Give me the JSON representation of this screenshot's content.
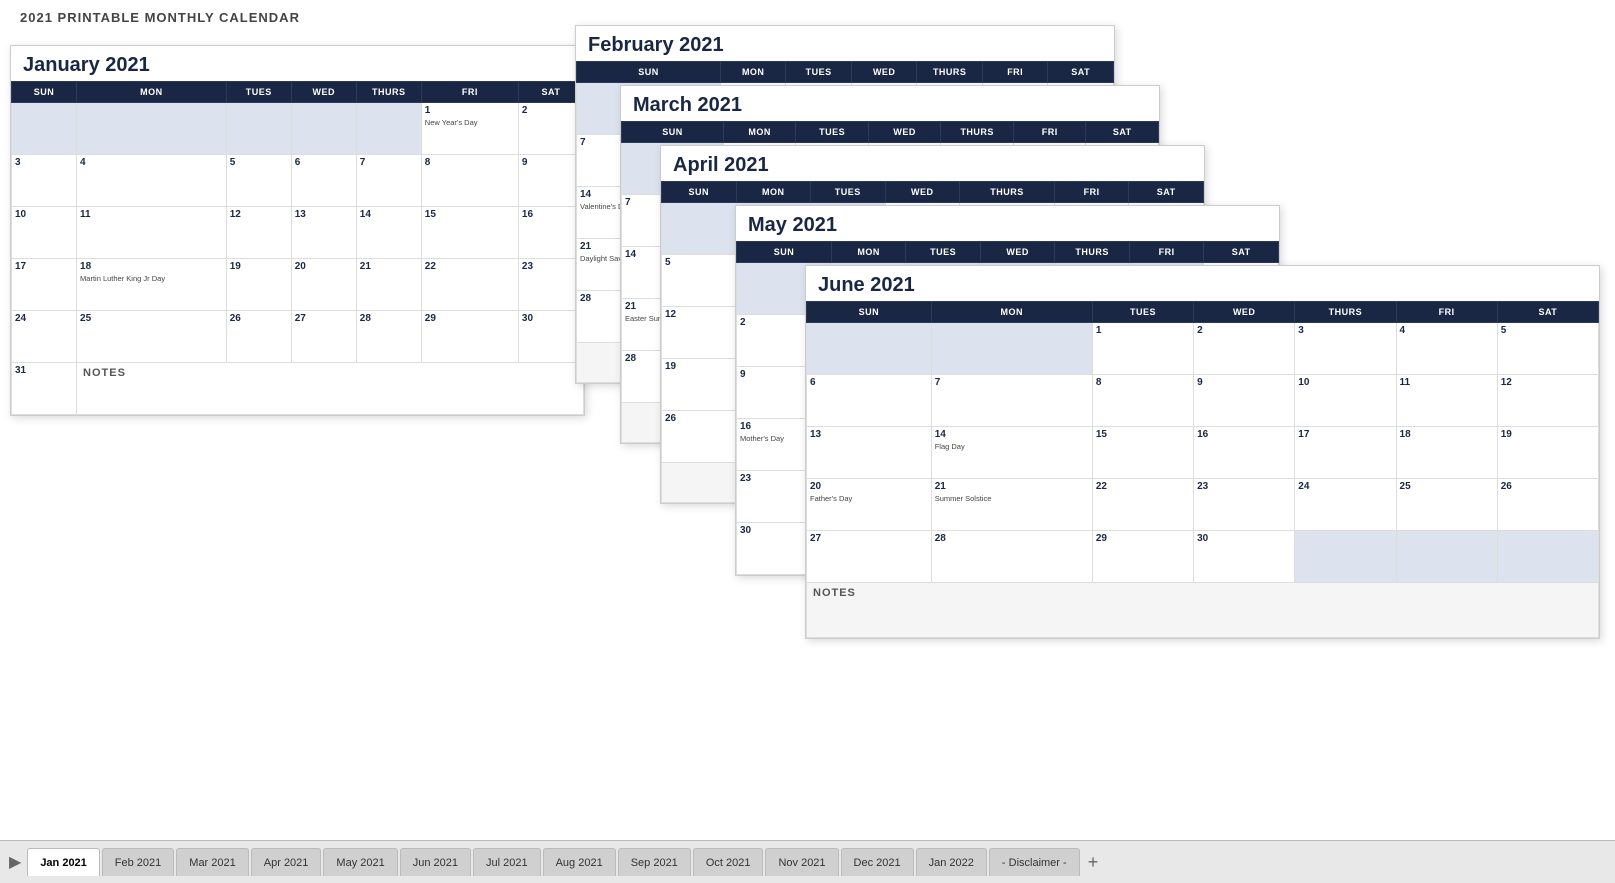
{
  "page": {
    "title": "2021 PRINTABLE MONTHLY CALENDAR"
  },
  "tabs": [
    {
      "label": "Jan 2021",
      "active": true
    },
    {
      "label": "Feb 2021",
      "active": false
    },
    {
      "label": "Mar 2021",
      "active": false
    },
    {
      "label": "Apr 2021",
      "active": false
    },
    {
      "label": "May 2021",
      "active": false
    },
    {
      "label": "Jun 2021",
      "active": false
    },
    {
      "label": "Jul 2021",
      "active": false
    },
    {
      "label": "Aug 2021",
      "active": false
    },
    {
      "label": "Sep 2021",
      "active": false
    },
    {
      "label": "Oct 2021",
      "active": false
    },
    {
      "label": "Nov 2021",
      "active": false
    },
    {
      "label": "Dec 2021",
      "active": false
    },
    {
      "label": "Jan 2022",
      "active": false
    },
    {
      "label": "- Disclaimer -",
      "active": false
    }
  ],
  "calendars": {
    "january": {
      "title": "January 2021",
      "headers": [
        "SUN",
        "MON",
        "TUES",
        "WED",
        "THURS",
        "FRI",
        "SAT"
      ]
    },
    "february": {
      "title": "February 2021",
      "headers": [
        "SUN",
        "MON",
        "TUES",
        "WED",
        "THURS",
        "FRI",
        "SAT"
      ]
    },
    "march": {
      "title": "March 2021",
      "headers": [
        "SUN",
        "MON",
        "TUES",
        "WED",
        "THURS",
        "FRI",
        "SAT"
      ]
    },
    "april": {
      "title": "April 2021",
      "headers": [
        "SUN",
        "MON",
        "TUES",
        "WED",
        "THURS",
        "FRI",
        "SAT"
      ]
    },
    "may": {
      "title": "May 2021",
      "headers": [
        "SUN",
        "MON",
        "TUES",
        "WED",
        "THURS",
        "FRI",
        "SAT"
      ]
    },
    "june": {
      "title": "June 2021",
      "headers": [
        "SUN",
        "MON",
        "TUES",
        "WED",
        "THURS",
        "FRI",
        "SAT"
      ]
    }
  },
  "notes_label": "NOTES",
  "add_tab_label": "+"
}
